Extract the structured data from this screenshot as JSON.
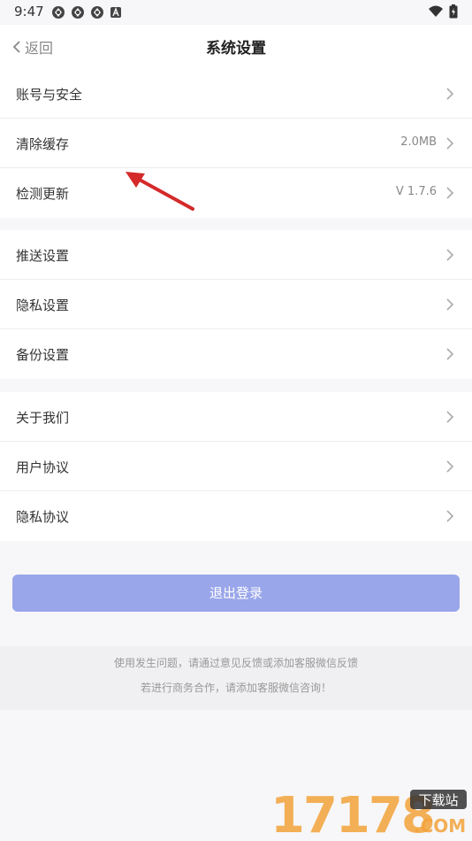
{
  "status_bar": {
    "time": "9:47"
  },
  "header": {
    "back_label": "返回",
    "title": "系统设置"
  },
  "groups": [
    {
      "items": [
        {
          "label": "账号与安全",
          "value": ""
        },
        {
          "label": "清除缓存",
          "value": "2.0MB"
        },
        {
          "label": "检测更新",
          "value": "V 1.7.6"
        }
      ]
    },
    {
      "items": [
        {
          "label": "推送设置",
          "value": ""
        },
        {
          "label": "隐私设置",
          "value": ""
        },
        {
          "label": "备份设置",
          "value": ""
        }
      ]
    },
    {
      "items": [
        {
          "label": "关于我们",
          "value": ""
        },
        {
          "label": "用户协议",
          "value": ""
        },
        {
          "label": "隐私协议",
          "value": ""
        }
      ]
    }
  ],
  "logout_label": "退出登录",
  "footer": {
    "line1": "使用发生问题，请通过意见反馈或添加客服微信反馈",
    "line2": "若进行商务合作，请添加客服微信咨询！"
  },
  "watermark": {
    "text": "17178",
    "badge": "下载站",
    "suffix": ".COM"
  },
  "colors": {
    "accent_button": "#9aa6ea",
    "annotation_arrow": "#d42a2a",
    "watermark_orange": "#f2a23a"
  }
}
